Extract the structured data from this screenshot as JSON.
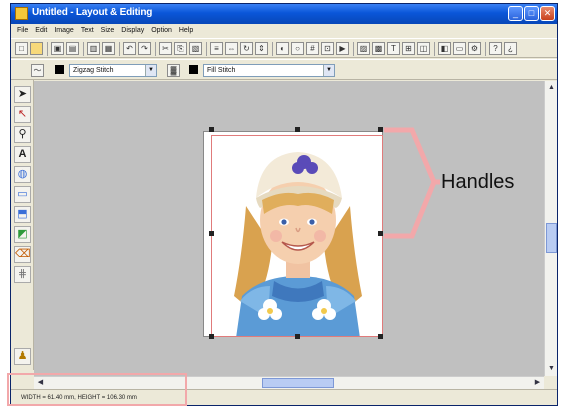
{
  "window": {
    "title": "Untitled - Layout & Editing"
  },
  "title_buttons": {
    "minimize": "_",
    "maximize": "□",
    "close": "✕"
  },
  "menu": [
    "File",
    "Edit",
    "Image",
    "Text",
    "Size",
    "Display",
    "Option",
    "Help"
  ],
  "toolbar2": {
    "stitch_combo": "Zigzag Stitch",
    "fill_combo": "Fill Stitch"
  },
  "status": {
    "text": "WIDTH = 61.40 mm, HEIGHT = 106.30 mm"
  },
  "annotation": {
    "label": "Handles"
  },
  "colors": {
    "highlight": "#f2a8aa",
    "canvas": "#c0c0c0",
    "selection": "#e07b7b"
  }
}
